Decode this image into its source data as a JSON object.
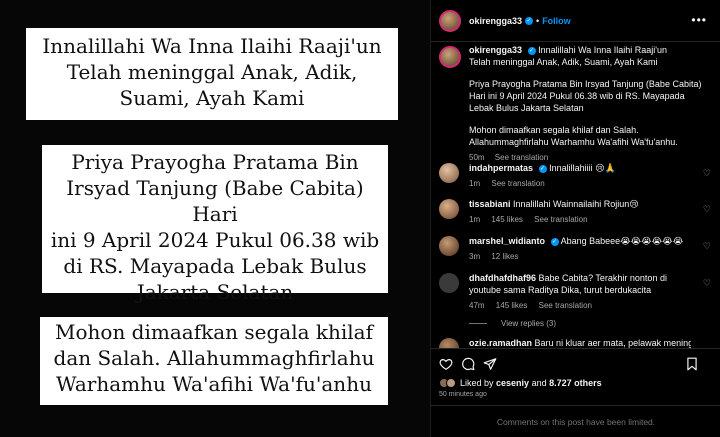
{
  "post_image": {
    "box1": [
      "Innalillahi Wa Inna Ilaihi Raaji'un",
      "Telah meninggal Anak, Adik,",
      "Suami, Ayah Kami"
    ],
    "box2": [
      "Priya Prayogha Pratama Bin",
      "Irsyad Tanjung (Babe Cabita) Hari",
      "ini 9 April 2024 Pukul 06.38 wib",
      "di RS. Mayapada Lebak Bulus",
      "Jakarta Selatan"
    ],
    "box3": [
      "Mohon dimaafkan segala khilaf",
      "dan Salah. Allahummaghfirlahu",
      "Warhamhu Wa'afihi Wa'fu'anhu"
    ]
  },
  "header": {
    "username": "okirengga33",
    "dot": "•",
    "follow_label": "Follow",
    "more": "•••"
  },
  "caption": {
    "username": "okirengga33",
    "line1": "Innalillahi Wa Inna Ilaihi Raaji'un",
    "line2": "Telah meninggal Anak, Adik, Suami, Ayah Kami",
    "para2": "Priya Prayogha Pratama Bin Irsyad Tanjung (Babe Cabita) Hari ini 9 April 2024 Pukul 06.38 wib di RS. Mayapada Lebak Bulus Jakarta Selatan",
    "para3": "Mohon dimaafkan segala khilaf dan Salah. Allahummaghfirlahu Warhamhu Wa'afihi Wa'fu'anhu.",
    "time": "50m",
    "see_translation": "See translation"
  },
  "comments": [
    {
      "username": "indahpermatas",
      "text": "Innalillahiiii 😢🙏",
      "time": "1m",
      "likes": "",
      "see_translation": "See translation"
    },
    {
      "username": "tissabiani",
      "text": "Innalillahi Wainnailaihi Rojiun😢",
      "time": "1m",
      "likes": "145 likes",
      "see_translation": "See translation"
    },
    {
      "username": "marshel_widianto",
      "text": "Abang Babeee😭😭😭😭😭😭",
      "time": "3m",
      "likes": "12 likes",
      "see_translation": ""
    },
    {
      "username": "dhafdhafdhaf96",
      "text": "Babe Cabita? Terakhir nonton di youtube sama Raditya Dika, turut berdukacita",
      "time": "47m",
      "likes": "145 likes",
      "see_translation": "See translation"
    }
  ],
  "view_replies": "View replies (3)",
  "partial_comment": {
    "username": "ozie.ramadhan",
    "text": "Baru ni kluar aer mata, pelawak meninggal.."
  },
  "likes": {
    "text_prefix": "Liked by ",
    "user": "ceseniy",
    "and": " and ",
    "count": "8.727 others"
  },
  "post_time": "50 minutes ago",
  "comments_limited": "Comments on this post have been limited."
}
